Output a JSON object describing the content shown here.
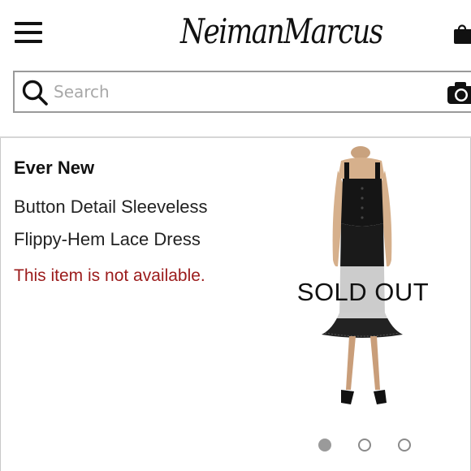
{
  "header": {
    "logo_text": "NeimanMarcus",
    "menu_icon": "hamburger-menu-icon",
    "bag_icon": "shopping-bag-icon"
  },
  "search": {
    "placeholder": "Search",
    "value": "",
    "search_icon": "search-icon",
    "camera_icon": "camera-icon"
  },
  "product": {
    "brand": "Ever New",
    "title_line_1": "Button Detail Sleeveless",
    "title_line_2": "Flippy-Hem Lace Dress",
    "availability": "This item is not available.",
    "badge": "SOLD OUT",
    "dress_color": "black lace"
  },
  "carousel": {
    "total_images": 3,
    "active_index": 1
  },
  "colors": {
    "availability_text": "#9b1b1b",
    "dot_active": "#9a9a9a",
    "border": "#9a9a9a"
  }
}
